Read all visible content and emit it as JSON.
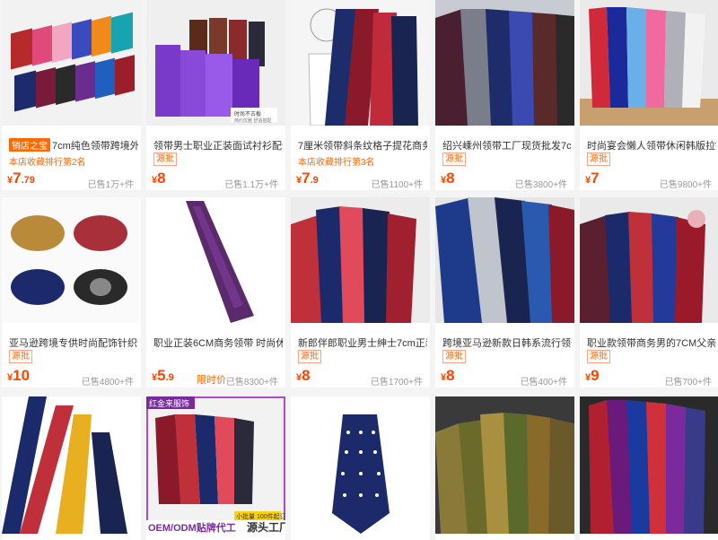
{
  "products": [
    {
      "title": "7cm纯色领带跨境外贸批",
      "shop_badge": "销店之宝",
      "rank": "本店收藏排行第2名",
      "price_int": "7",
      "price_dec": ".79",
      "sold": "已售1万+件"
    },
    {
      "title": "领带男士职业正装面试衬衫配饰冬",
      "tag": "源批",
      "price_int": "8",
      "price_dec": "",
      "sold": "已售1.1万+件",
      "img_caption_1": "时尚不古板",
      "img_caption_2": "简约优雅  舒适搭配"
    },
    {
      "title": "7厘米领带斜条纹格子提花商务正",
      "rank": "本店收藏排行第3名",
      "price_int": "7",
      "price_dec": ".9",
      "sold": "已售1100+件"
    },
    {
      "title": "绍兴嵊州领带工厂现货批发7cm男",
      "tag": "源批",
      "price_int": "8",
      "price_dec": "",
      "sold": "已售3800+件"
    },
    {
      "title": "时尚宴会懒人领带休闲韩版拉链领",
      "tag": "源批",
      "price_int": "7",
      "price_dec": "",
      "sold": "已售9800+件"
    },
    {
      "title": "亚马逊跨境专供时尚配饰针织领带",
      "tag": "源批",
      "price_int": "10",
      "price_dec": "",
      "sold": "已售4800+件"
    },
    {
      "title": "职业正装6CM商务领带 时尚休闲",
      "price_int": "5",
      "price_dec": ".9",
      "limited": "限时价",
      "sold": "已售8300+件"
    },
    {
      "title": "新郎伴郎职业男士绅士7cm正装领",
      "tag": "源批",
      "price_int": "8",
      "price_dec": "",
      "sold": "已售1700+件"
    },
    {
      "title": "跨境亚马逊新款日韩系流行领部配",
      "tag": "源批",
      "price_int": "8",
      "price_dec": "",
      "sold": "已售400+件"
    },
    {
      "title": "职业款领带商务男的7CM父亲节",
      "tag": "源批",
      "price_int": "9",
      "price_dec": "",
      "sold": "已售700+件"
    },
    {
      "title": ""
    },
    {
      "title": "",
      "overlay_top": "红金来服饰",
      "overlay_badge": "小批量 100件起订",
      "overlay_left": "OEM/ODM贴牌代工",
      "overlay_right": "源头工厂"
    },
    {
      "title": ""
    },
    {
      "title": ""
    },
    {
      "title": ""
    }
  ],
  "colors": {
    "price": "#ff4400",
    "tag_border": "#f9a58c",
    "accent": "#ff6a00"
  }
}
